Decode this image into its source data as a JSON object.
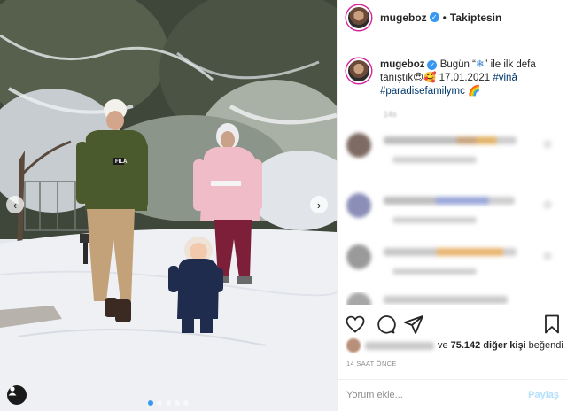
{
  "photo": {
    "prev_arrow": "‹",
    "next_arrow": "›",
    "jacket_text": "FILA",
    "dot_count": 5,
    "active_dot": 0
  },
  "header": {
    "username": "mugeboz",
    "separator": "•",
    "follow_label": "Takiptesin"
  },
  "caption": {
    "username": "mugeboz",
    "text_a": "Bugün “",
    "emoji_snow": "❄",
    "text_b": "” ile ilk defa tanıştık",
    "emoji_faces": "😍🥰",
    "date": " 17.01.2021 ",
    "hashtag1": "#vinâ",
    "hashtag2": "#paradisefamilymc",
    "emoji_rainbow": " 🌈",
    "time": "14s"
  },
  "actions": {
    "like_icon": "heart-icon",
    "comment_icon": "comment-icon",
    "share_icon": "share-icon",
    "save_icon": "bookmark-icon"
  },
  "likes": {
    "connector": "ve",
    "count": "75.142 diğer kişi",
    "suffix": "beğendi"
  },
  "post_time": "14 SAAT ÖNCE",
  "comment_box": {
    "placeholder": "Yorum ekle...",
    "post_label": "Paylaş"
  },
  "colors": {
    "accent": "#3897f0",
    "hashtag": "#00376b",
    "post_disabled": "#b2dffc"
  }
}
